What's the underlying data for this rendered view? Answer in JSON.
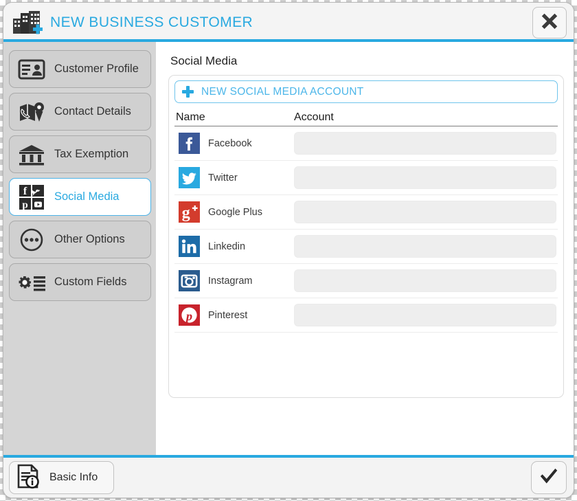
{
  "window": {
    "title": "NEW BUSINESS CUSTOMER",
    "title_icon": "building-plus-icon",
    "close_icon": "close-icon",
    "accent_color": "#29a9e0"
  },
  "sidebar": {
    "items": [
      {
        "label": "Customer Profile",
        "icon": "id-card-icon",
        "active": false
      },
      {
        "label": "Contact Details",
        "icon": "map-phone-pin-icon",
        "active": false
      },
      {
        "label": "Tax Exemption",
        "icon": "bank-icon",
        "active": false
      },
      {
        "label": "Social Media",
        "icon": "social-grid-icon",
        "active": true
      },
      {
        "label": "Other Options",
        "icon": "ellipsis-circle-icon",
        "active": false
      },
      {
        "label": "Custom Fields",
        "icon": "gear-list-icon",
        "active": false
      }
    ]
  },
  "main": {
    "section_title": "Social Media",
    "new_account_button": {
      "label": "NEW SOCIAL MEDIA ACCOUNT",
      "icon": "plus-icon"
    },
    "table": {
      "columns": [
        "Name",
        "Account"
      ],
      "rows": [
        {
          "name": "Facebook",
          "icon": "facebook-icon",
          "color": "#3b5998",
          "account": ""
        },
        {
          "name": "Twitter",
          "icon": "twitter-icon",
          "color": "#29a9e0",
          "account": ""
        },
        {
          "name": "Google Plus",
          "icon": "google-plus-icon",
          "color": "#d33c2d",
          "account": ""
        },
        {
          "name": "Linkedin",
          "icon": "linkedin-icon",
          "color": "#1d6ca8",
          "account": ""
        },
        {
          "name": "Instagram",
          "icon": "instagram-icon",
          "color": "#2b5c8e",
          "account": ""
        },
        {
          "name": "Pinterest",
          "icon": "pinterest-icon",
          "color": "#c8232c",
          "account": ""
        }
      ]
    }
  },
  "footer": {
    "basic_info": {
      "label": "Basic Info",
      "icon": "document-info-icon"
    },
    "confirm": {
      "icon": "checkmark-icon"
    }
  }
}
